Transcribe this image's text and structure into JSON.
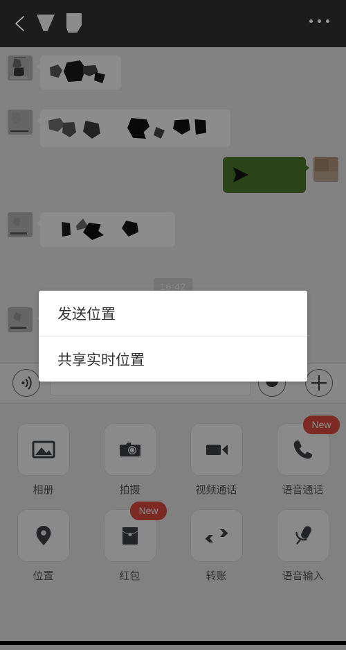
{
  "header": {
    "back_icon": "back-chevron-icon",
    "title_redacted_a": "redacted-title-shape",
    "title_redacted_b": "redacted-title-shape",
    "more_icon": "more-options-icon"
  },
  "chat": {
    "timestamp": "16:42",
    "messages": [
      {
        "side": "left",
        "avatar": "contact-avatar",
        "content": "redacted-message-content"
      },
      {
        "side": "left",
        "avatar": "contact-avatar",
        "content": "redacted-message-content"
      },
      {
        "side": "right",
        "avatar": "self-avatar",
        "content": "redacted-message-content"
      },
      {
        "side": "left",
        "avatar": "contact-avatar",
        "content": "redacted-message-content"
      },
      {
        "side": "left",
        "avatar": "contact-avatar",
        "content": "redacted-message-content"
      }
    ]
  },
  "input_bar": {
    "voice_icon": "voice-input-icon",
    "text_value": "",
    "text_placeholder": "",
    "emoji_icon": "emoji-icon",
    "plus_icon": "plus-icon"
  },
  "attachment_panel": {
    "items": [
      {
        "label": "相册",
        "icon": "photo-album-icon",
        "badge": null
      },
      {
        "label": "拍摄",
        "icon": "camera-icon",
        "badge": null
      },
      {
        "label": "视频通话",
        "icon": "video-call-icon",
        "badge": null
      },
      {
        "label": "语音通话",
        "icon": "phone-call-icon",
        "badge": "New"
      },
      {
        "label": "位置",
        "icon": "location-pin-icon",
        "badge": null
      },
      {
        "label": "红包",
        "icon": "red-packet-icon",
        "badge": "New"
      },
      {
        "label": "转账",
        "icon": "transfer-icon",
        "badge": null
      },
      {
        "label": "语音输入",
        "icon": "microphone-icon",
        "badge": null
      }
    ]
  },
  "action_sheet": {
    "options": [
      {
        "label": "发送位置"
      },
      {
        "label": "共享实时位置"
      }
    ]
  },
  "colors": {
    "header_bg": "#1c1c1c",
    "chat_bg": "#ededed",
    "outgoing_bubble": "#95ec69",
    "incoming_bubble": "#ffffff",
    "badge_red": "#e54d42",
    "sheet_bg": "#ffffff",
    "scrim": "rgba(0,0,0,0.45)"
  }
}
